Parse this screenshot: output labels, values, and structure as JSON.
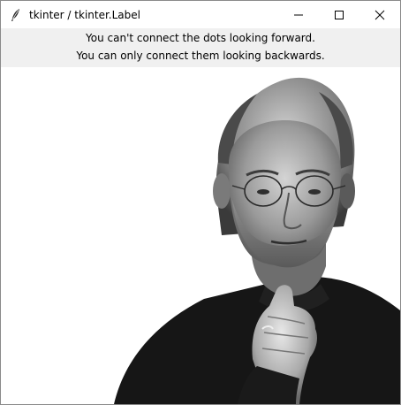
{
  "window": {
    "title": "tkinter / tkinter.Label",
    "icon": "feather-icon",
    "controls": [
      "minimize-icon",
      "maximize-icon",
      "close-icon"
    ]
  },
  "label": {
    "line1": "You can't connect the dots looking forward.",
    "line2": "You can only connect them looking backwards."
  },
  "image": {
    "subject": "black-and-white portrait photo",
    "background_color": "#ffffff"
  },
  "colors": {
    "label_background": "#f0f0f0",
    "titlebar_background": "#ffffff"
  }
}
